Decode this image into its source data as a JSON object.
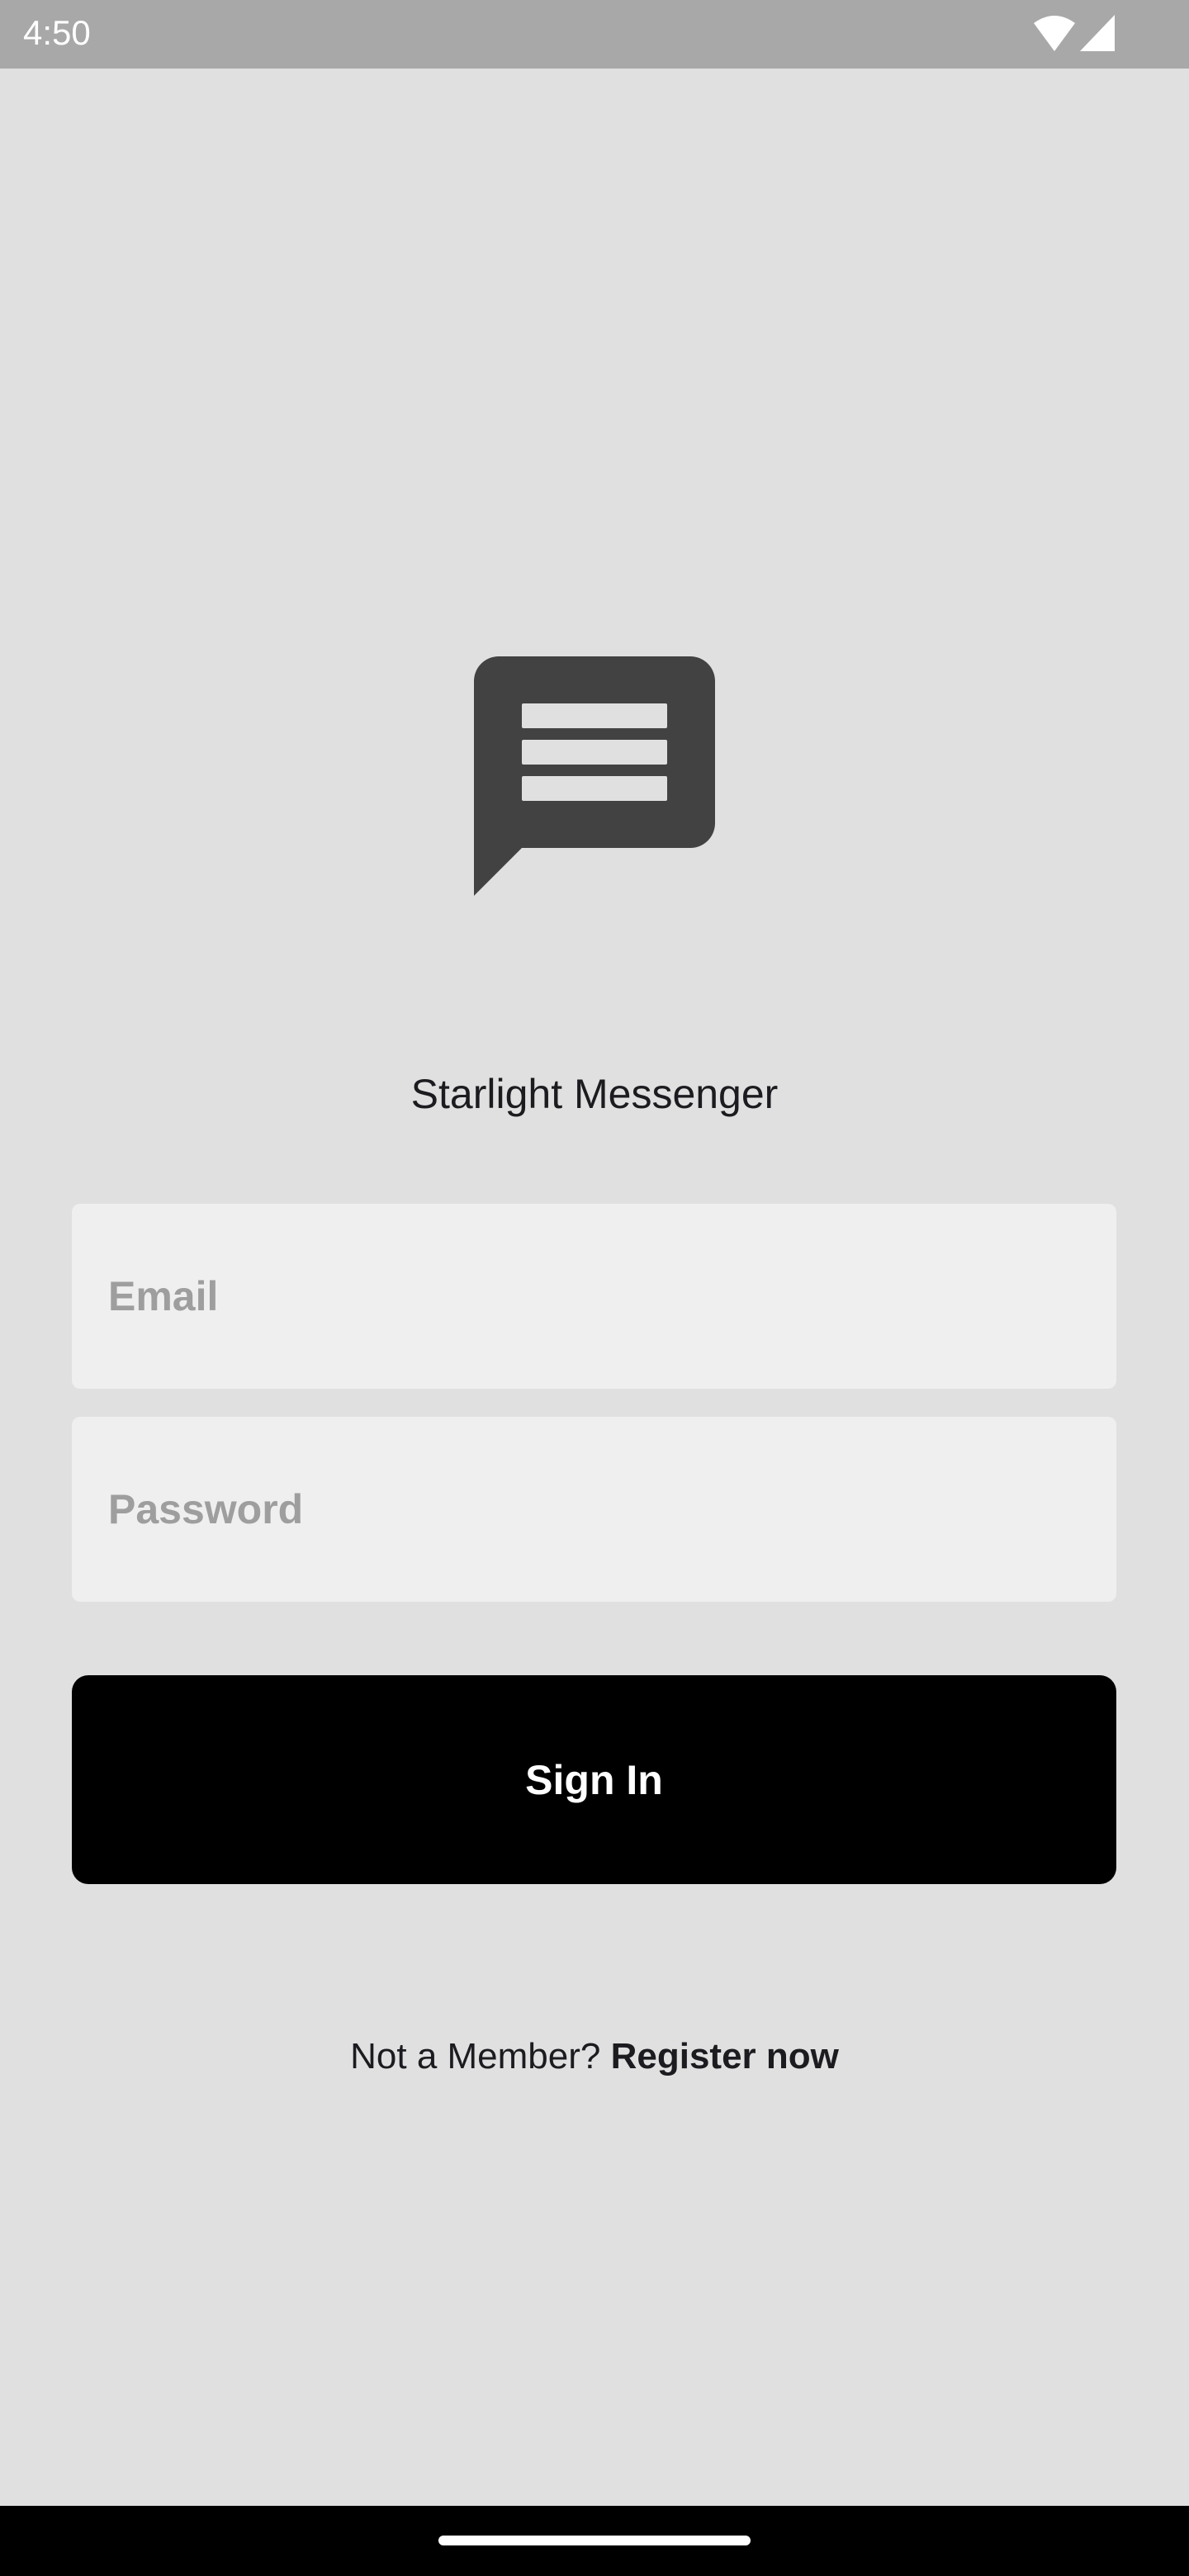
{
  "status_bar": {
    "time": "4:50",
    "icons": [
      "wifi-icon",
      "cellular-signal-icon"
    ]
  },
  "app": {
    "logo_icon": "chat-bubble-lines-icon",
    "title": "Starlight Messenger"
  },
  "form": {
    "email": {
      "value": "",
      "placeholder": "Email"
    },
    "password": {
      "value": "",
      "placeholder": "Password"
    },
    "sign_in_label": "Sign In"
  },
  "footer": {
    "prompt": "Not a Member?",
    "register_label": "Register now"
  },
  "colors": {
    "background": "#e0e0e0",
    "button": "#000000",
    "field": "#efefef",
    "logo": "#424242"
  }
}
